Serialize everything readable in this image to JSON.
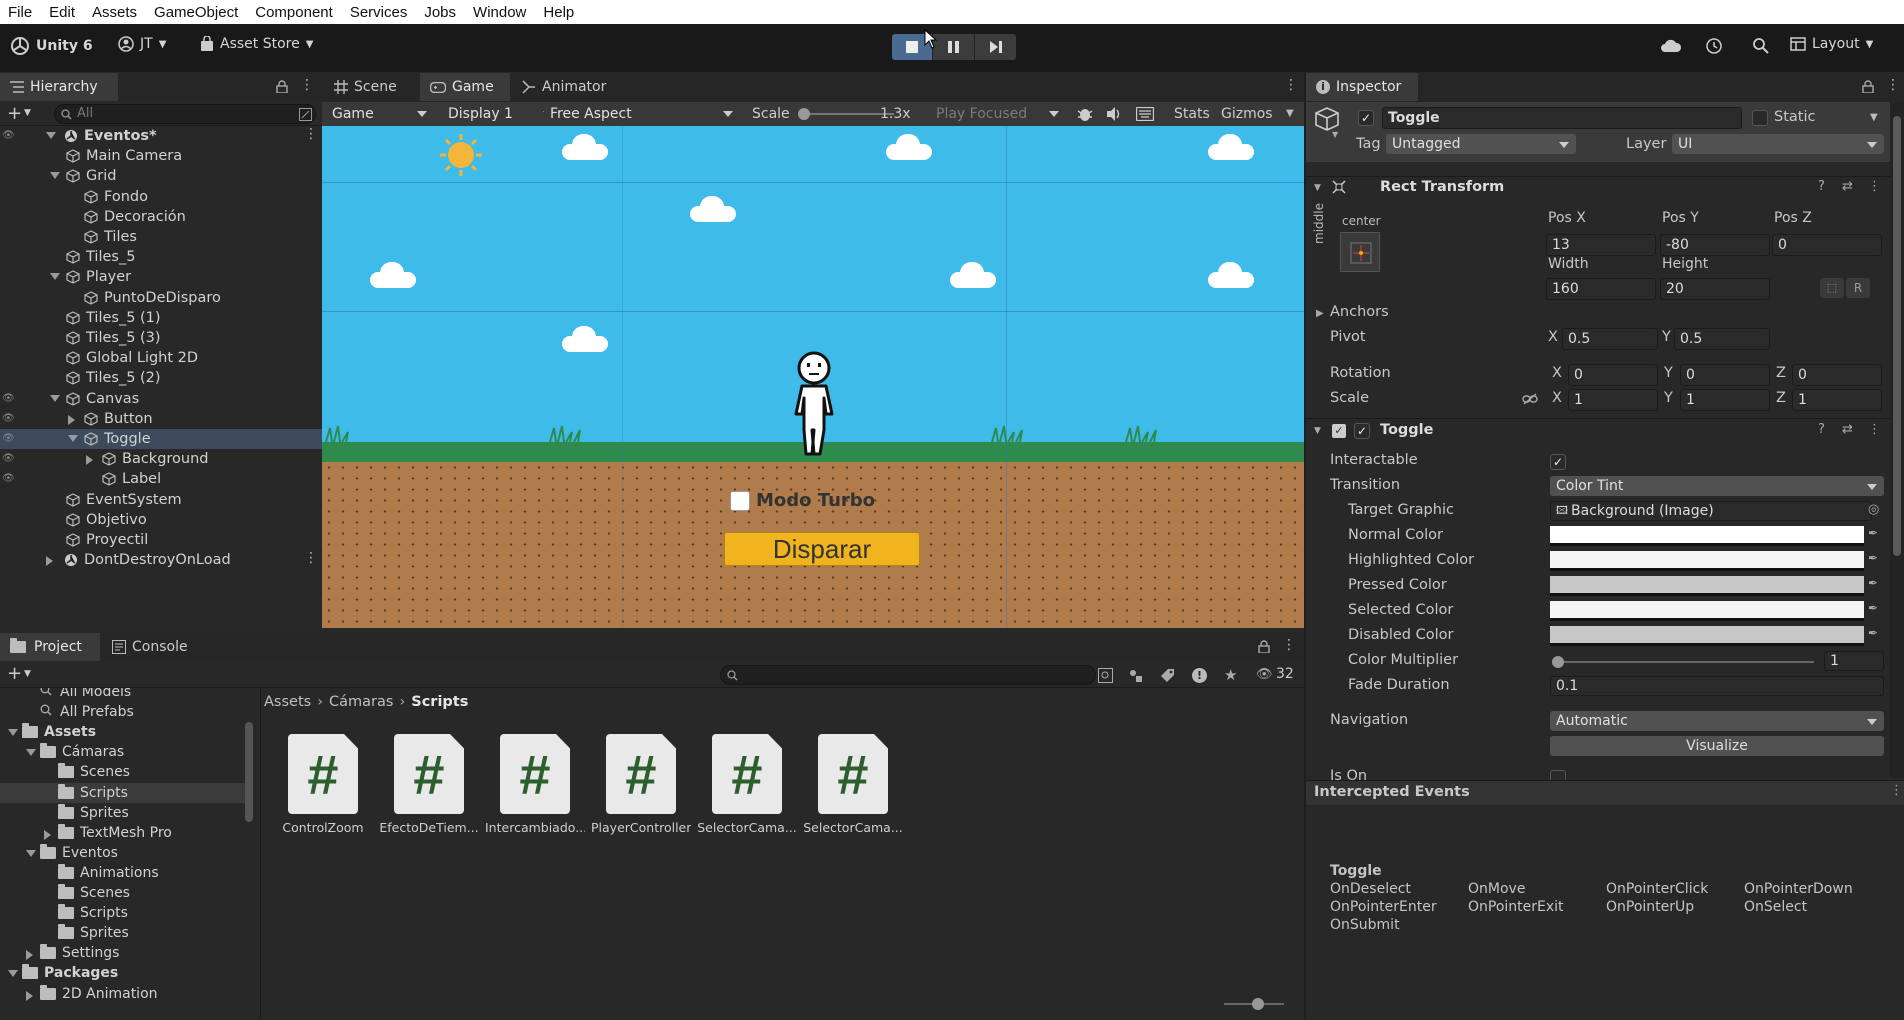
{
  "menu": [
    "File",
    "Edit",
    "Assets",
    "GameObject",
    "Component",
    "Services",
    "Jobs",
    "Window",
    "Help"
  ],
  "toolbar": {
    "unity": "Unity 6",
    "account": "JT",
    "store": "Asset Store",
    "layout": "Layout"
  },
  "tabs": {
    "hierarchy": "Hierarchy",
    "scene": "Scene",
    "game": "Game",
    "animator": "Animator",
    "inspector": "Inspector",
    "project": "Project",
    "console": "Console"
  },
  "hierarchy": {
    "search_placeholder": "All",
    "rows": [
      {
        "label": "Eventos*",
        "depth": 0,
        "arrow": "down",
        "icon": "unity",
        "bold": true
      },
      {
        "label": "Main Camera",
        "depth": 1,
        "arrow": "none",
        "icon": "cube"
      },
      {
        "label": "Grid",
        "depth": 1,
        "arrow": "down",
        "icon": "cube"
      },
      {
        "label": "Fondo",
        "depth": 2,
        "arrow": "none",
        "icon": "cube"
      },
      {
        "label": "Decoración",
        "depth": 2,
        "arrow": "none",
        "icon": "cube"
      },
      {
        "label": "Tiles",
        "depth": 2,
        "arrow": "none",
        "icon": "cube"
      },
      {
        "label": "Tiles_5",
        "depth": 1,
        "arrow": "none",
        "icon": "cube"
      },
      {
        "label": "Player",
        "depth": 1,
        "arrow": "down",
        "icon": "cube"
      },
      {
        "label": "PuntoDeDisparo",
        "depth": 2,
        "arrow": "none",
        "icon": "cube"
      },
      {
        "label": "Tiles_5 (1)",
        "depth": 1,
        "arrow": "none",
        "icon": "cube"
      },
      {
        "label": "Tiles_5 (3)",
        "depth": 1,
        "arrow": "none",
        "icon": "cube"
      },
      {
        "label": "Global Light 2D",
        "depth": 1,
        "arrow": "none",
        "icon": "cube"
      },
      {
        "label": "Tiles_5 (2)",
        "depth": 1,
        "arrow": "none",
        "icon": "cube"
      },
      {
        "label": "Canvas",
        "depth": 1,
        "arrow": "down",
        "icon": "cube"
      },
      {
        "label": "Button",
        "depth": 2,
        "arrow": "right",
        "icon": "cube"
      },
      {
        "label": "Toggle",
        "depth": 2,
        "arrow": "down",
        "icon": "cube",
        "selected": true
      },
      {
        "label": "Background",
        "depth": 3,
        "arrow": "right",
        "icon": "cube"
      },
      {
        "label": "Label",
        "depth": 3,
        "arrow": "none",
        "icon": "cube"
      },
      {
        "label": "EventSystem",
        "depth": 1,
        "arrow": "none",
        "icon": "cube"
      },
      {
        "label": "Objetivo",
        "depth": 1,
        "arrow": "none",
        "icon": "cube"
      },
      {
        "label": "Proyectil",
        "depth": 1,
        "arrow": "none",
        "icon": "cube"
      },
      {
        "label": "DontDestroyOnLoad",
        "depth": 0,
        "arrow": "right",
        "icon": "unity"
      }
    ]
  },
  "game_toolbar": {
    "view": "Game",
    "display": "Display 1",
    "aspect": "Free Aspect",
    "scale_label": "Scale",
    "scale_value": "1.3x",
    "play_mode": "Play Focused",
    "stats": "Stats",
    "gizmos": "Gizmos"
  },
  "game_view": {
    "toggle_label": "Modo Turbo",
    "button_label": "Disparar",
    "colors": {
      "sky": "#3ebbe9",
      "ground": "#b07c4c",
      "grass": "#2f8a4e",
      "button": "#f0b41e"
    }
  },
  "inspector": {
    "object_name": "Toggle",
    "static_label": "Static",
    "tag_label": "Tag",
    "tag_value": "Untagged",
    "layer_label": "Layer",
    "layer_value": "UI",
    "rect_transform": {
      "title": "Rect Transform",
      "anchor_h": "center",
      "anchor_v": "middle",
      "posx_label": "Pos X",
      "posx": "13",
      "posy_label": "Pos Y",
      "posy": "-80",
      "posz_label": "Pos Z",
      "posz": "0",
      "width_label": "Width",
      "width": "160",
      "height_label": "Height",
      "height": "20",
      "anchors": "Anchors",
      "pivot": "Pivot",
      "pivot_x": "0.5",
      "pivot_y": "0.5",
      "rotation": "Rotation",
      "rot_x": "0",
      "rot_y": "0",
      "rot_z": "0",
      "scale": "Scale",
      "scale_x": "1",
      "scale_y": "1",
      "scale_z": "1",
      "x": "X",
      "y": "Y",
      "z": "Z",
      "r": "R"
    },
    "toggle": {
      "title": "Toggle",
      "interactable": "Interactable",
      "transition": "Transition",
      "transition_value": "Color Tint",
      "target_graphic": "Target Graphic",
      "target_value": "Background (Image)",
      "normal": "Normal Color",
      "highlighted": "Highlighted Color",
      "pressed": "Pressed Color",
      "selected": "Selected Color",
      "disabled": "Disabled Color",
      "multiplier": "Color Multiplier",
      "multiplier_value": "1",
      "fade": "Fade Duration",
      "fade_value": "0.1",
      "navigation": "Navigation",
      "navigation_value": "Automatic",
      "visualize": "Visualize",
      "is_on": "Is On"
    },
    "intercepted": {
      "title": "Intercepted Events",
      "group": "Toggle",
      "events": [
        "OnDeselect",
        "OnMove",
        "OnPointerClick",
        "OnPointerDown",
        "OnPointerEnter",
        "OnPointerExit",
        "OnPointerUp",
        "OnSelect",
        "OnSubmit"
      ]
    }
  },
  "project": {
    "count": "32",
    "breadcrumb": [
      "Assets",
      "Cámaras",
      "Scripts"
    ],
    "tree": [
      {
        "label": "All Models",
        "depth": 1,
        "kind": "search"
      },
      {
        "label": "All Prefabs",
        "depth": 1,
        "kind": "search"
      },
      {
        "label": "Assets",
        "depth": 0,
        "kind": "folder",
        "arrow": "down",
        "bold": true
      },
      {
        "label": "Cámaras",
        "depth": 1,
        "kind": "folder",
        "arrow": "down"
      },
      {
        "label": "Scenes",
        "depth": 2,
        "kind": "folder"
      },
      {
        "label": "Scripts",
        "depth": 2,
        "kind": "folder",
        "selected": true
      },
      {
        "label": "Sprites",
        "depth": 2,
        "kind": "folder"
      },
      {
        "label": "TextMesh Pro",
        "depth": 2,
        "kind": "folder",
        "arrow": "right"
      },
      {
        "label": "Eventos",
        "depth": 1,
        "kind": "folder",
        "arrow": "down"
      },
      {
        "label": "Animations",
        "depth": 2,
        "kind": "folder"
      },
      {
        "label": "Scenes",
        "depth": 2,
        "kind": "folder"
      },
      {
        "label": "Scripts",
        "depth": 2,
        "kind": "folder"
      },
      {
        "label": "Sprites",
        "depth": 2,
        "kind": "folder"
      },
      {
        "label": "Settings",
        "depth": 1,
        "kind": "folder",
        "arrow": "right"
      },
      {
        "label": "Packages",
        "depth": 0,
        "kind": "folder",
        "arrow": "down",
        "bold": true
      },
      {
        "label": "2D Animation",
        "depth": 1,
        "kind": "folder",
        "arrow": "right"
      }
    ],
    "assets": [
      "ControlZoom",
      "EfectoDeTiem...",
      "Intercambiado...",
      "PlayerController",
      "SelectorCama...",
      "SelectorCama..."
    ]
  }
}
